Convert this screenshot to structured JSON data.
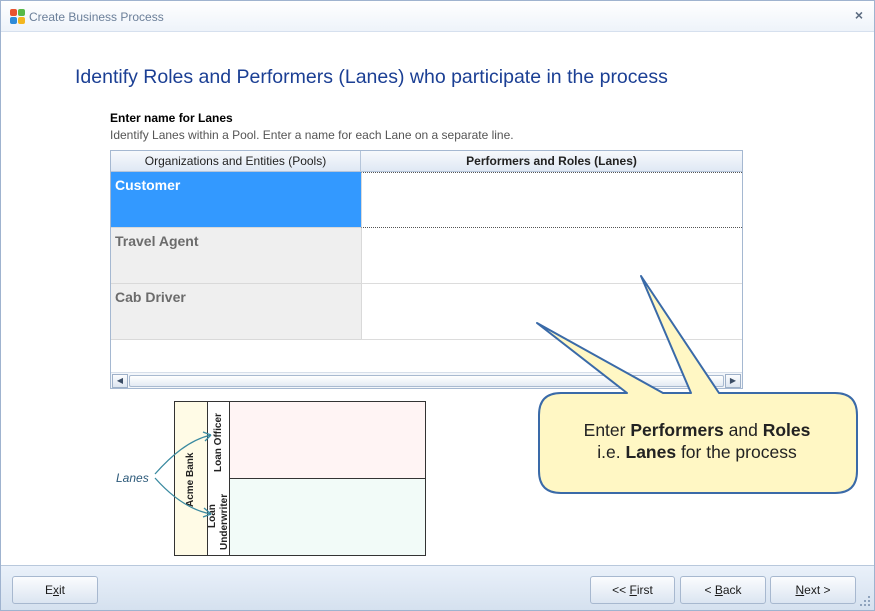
{
  "window": {
    "title": "Create Business Process",
    "close_glyph": "×"
  },
  "main": {
    "heading": "Identify Roles and Performers (Lanes) who participate in the process",
    "section_title": "Enter name for Lanes",
    "section_desc": "Identify Lanes within a Pool. Enter a name for each Lane on a separate line."
  },
  "grid": {
    "columns": [
      "Organizations and Entities (Pools)",
      "Performers and Roles (Lanes)"
    ],
    "rows": [
      {
        "pool": "Customer",
        "lanes": "",
        "selected": true
      },
      {
        "pool": "Travel Agent",
        "lanes": ""
      },
      {
        "pool": "Cab Driver",
        "lanes": ""
      }
    ]
  },
  "illustration": {
    "pool_label": "Acme Bank",
    "lane1_label": "Loan Officer",
    "lane2_label_line1": "Loan",
    "lane2_label_line2": "Underwriter",
    "annotation": "Lanes"
  },
  "callout": {
    "part1": "Enter ",
    "bold1": "Performers",
    "part2": " and ",
    "bold2": "Roles",
    "part3": "i.e. ",
    "bold3": "Lanes",
    "part4": " for the process"
  },
  "footer": {
    "exit_label": "Exit",
    "exit_mnemonic": "x",
    "first_label_prefix": "<< ",
    "first_label_mnemonic": "F",
    "first_label_rest": "irst",
    "back_label_prefix": "< ",
    "back_label_mnemonic": "B",
    "back_label_rest": "ack",
    "next_label_mnemonic": "N",
    "next_label_rest": "ext >"
  },
  "colors": {
    "heading": "#1b3f94",
    "selected_row": "#3399ff",
    "callout_fill": "#fff7c4",
    "callout_border": "#3a6aa8"
  }
}
